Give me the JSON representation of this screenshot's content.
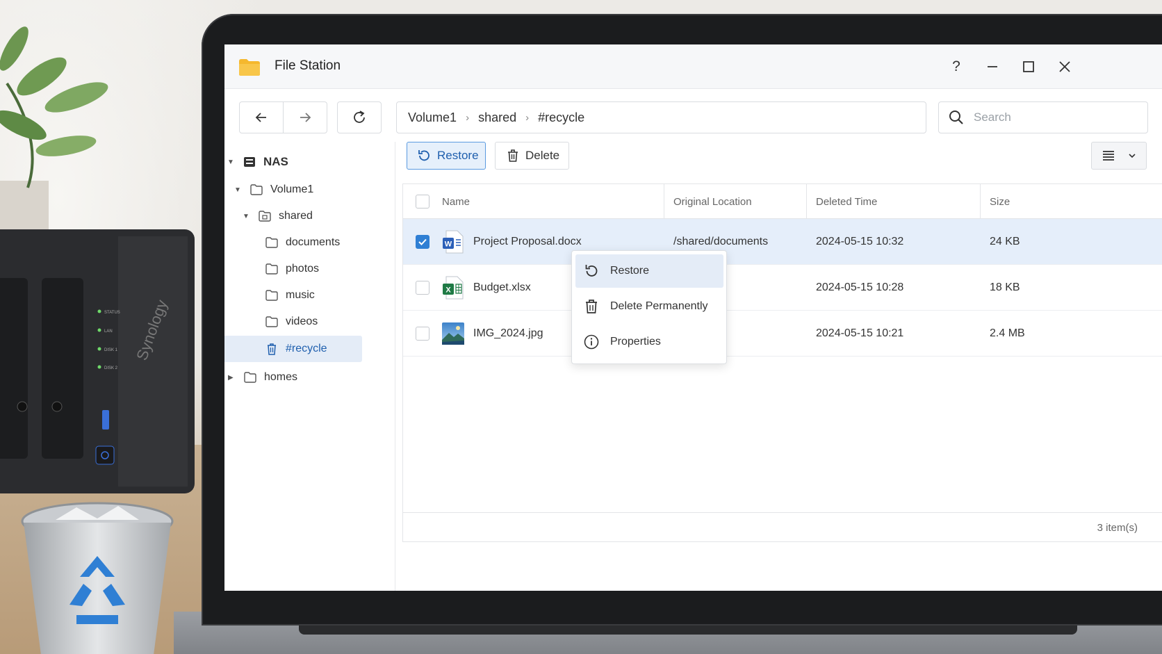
{
  "window": {
    "title": "File Station",
    "controls": {
      "help": "?"
    }
  },
  "toolbar": {
    "path": [
      "Volume1",
      "shared",
      "#recycle"
    ],
    "path_separator": "›",
    "search_placeholder": "Search"
  },
  "actions": {
    "restore_label": "Restore",
    "delete_label": "Delete"
  },
  "sidebar": {
    "root": "NAS",
    "items": [
      {
        "label": "Volume1"
      },
      {
        "label": "shared"
      },
      {
        "label": "documents"
      },
      {
        "label": "photos"
      },
      {
        "label": "music"
      },
      {
        "label": "videos"
      },
      {
        "label": "#recycle"
      },
      {
        "label": "homes"
      }
    ]
  },
  "table": {
    "columns": [
      "Name",
      "Original Location",
      "Deleted Time",
      "Size"
    ],
    "rows": [
      {
        "name": "Project Proposal.docx",
        "location": "/shared/documents",
        "deleted": "2024-05-15 10:32",
        "size": "24 KB",
        "checked": true,
        "icon": "word-doc-icon"
      },
      {
        "name": "Budget.xlsx",
        "location": "",
        "deleted": "2024-05-15 10:28",
        "size": "18 KB",
        "checked": false,
        "icon": "excel-sheet-icon"
      },
      {
        "name": "IMG_2024.jpg",
        "location": "",
        "deleted": "2024-05-15 10:21",
        "size": "2.4 MB",
        "checked": false,
        "icon": "image-file-icon"
      }
    ],
    "footer": "3 item(s)"
  },
  "context_menu": {
    "items": [
      {
        "label": "Restore",
        "icon": "restore-icon"
      },
      {
        "label": "Delete Permanently",
        "icon": "trash-icon"
      },
      {
        "label": "Properties",
        "icon": "info-icon"
      }
    ]
  },
  "device": {
    "brand": "Synology",
    "leds": [
      "STATUS",
      "LAN",
      "DISK 1",
      "DISK 2"
    ]
  },
  "colors": {
    "accent": "#2f7fd4",
    "selection": "#e5eefa",
    "folder": "#f5b82e"
  }
}
